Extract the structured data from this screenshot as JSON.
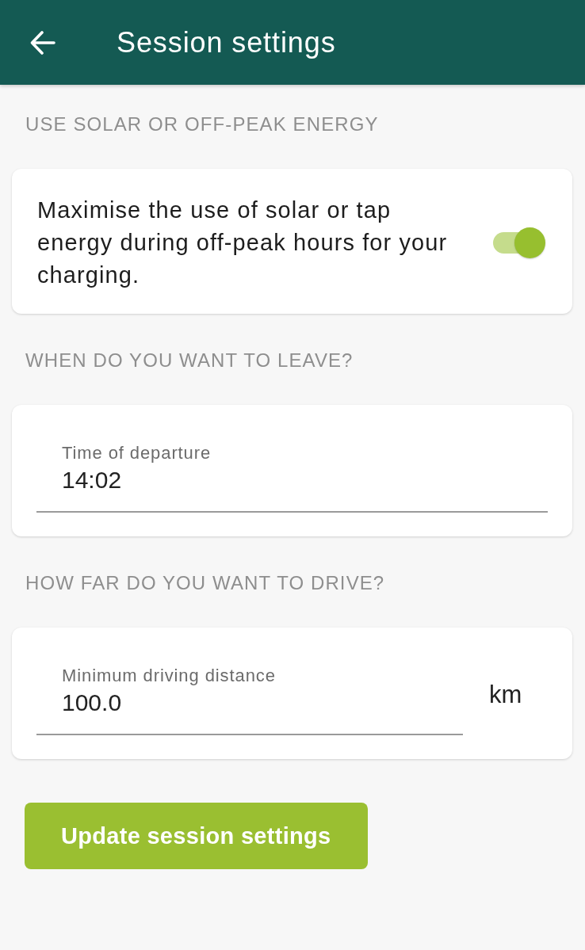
{
  "app_bar": {
    "title": "Session settings"
  },
  "sections": [
    {
      "heading": "USE SOLAR OR OFF-PEAK ENERGY",
      "kind": "toggle",
      "description": "Maximise the use of solar or tap energy during off-peak hours for your charging.",
      "on": true
    },
    {
      "heading": "WHEN DO YOU WANT TO LEAVE?",
      "kind": "field",
      "label": "Time of departure",
      "value": "14:02"
    },
    {
      "heading": "HOW FAR DO YOU WANT TO DRIVE?",
      "kind": "field",
      "label": "Minimum driving distance",
      "value": "100.0",
      "unit": "km"
    }
  ],
  "button": {
    "label": "Update session settings"
  }
}
